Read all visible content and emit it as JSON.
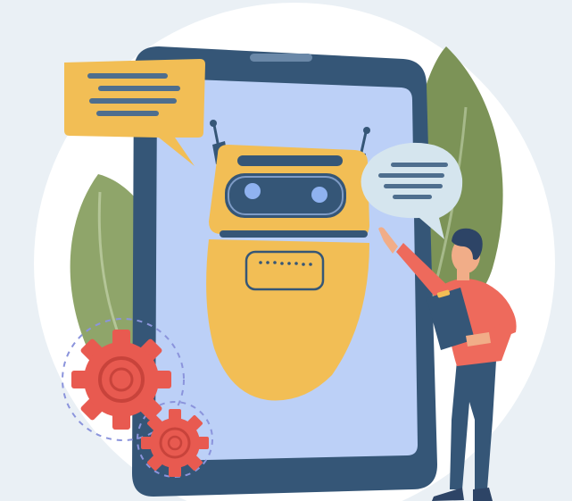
{
  "illustration": {
    "subject": "chatbot",
    "colors": {
      "background": "#eaf0f5",
      "backdrop_circle": "#ffffff",
      "phone_frame": "#355677",
      "phone_screen": "#bcd0f7",
      "robot_body": "#f2be55",
      "robot_visor": "#355677",
      "robot_eyes": "#8fb2f0",
      "speech_bubble_left": "#f2be55",
      "speech_bubble_right": "#d5e5ee",
      "bubble_lines": "#4e6e8e",
      "leaf_light": "#8fa56a",
      "leaf_dark": "#7c9357",
      "gear": "#e85a50",
      "person_shirt": "#ee6a5c",
      "person_pants": "#355677",
      "person_hair": "#2d4466",
      "person_skin": "#f1ad88",
      "clipboard": "#355677"
    },
    "icons": [
      "robot-icon",
      "gear-icon",
      "speech-bubble-icon",
      "smartphone-icon",
      "leaf-icon",
      "person-icon"
    ]
  }
}
